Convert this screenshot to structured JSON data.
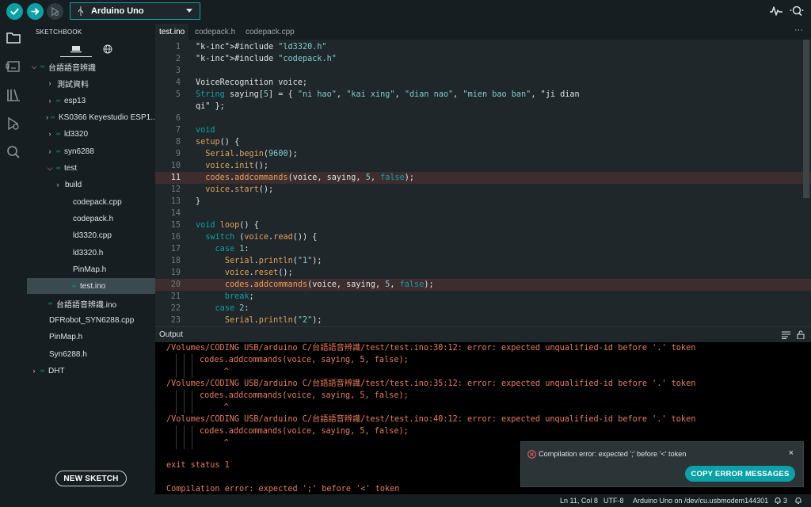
{
  "toolbar": {
    "board_label": "Arduino Uno",
    "verify_icon": "check-icon",
    "upload_icon": "arrow-right-icon",
    "debug_icon": "debug-icon",
    "accent_color": "#0ca1a6"
  },
  "sidebar": {
    "title": "SKETCHBOOK",
    "tree": [
      {
        "label": "台語語音辨識",
        "caret": "⌵",
        "sketch": true
      },
      {
        "label": "測試資料",
        "caret": "›",
        "sketch": false
      },
      {
        "label": "esp13",
        "caret": "›",
        "sketch": true
      },
      {
        "label": "KS0366 Keyestudio ESP1...",
        "caret": "›",
        "sketch": true
      },
      {
        "label": "ld3320",
        "caret": "›",
        "sketch": true
      },
      {
        "label": "syn6288",
        "caret": "›",
        "sketch": true
      },
      {
        "label": "test",
        "caret": "⌵",
        "sketch": true
      },
      {
        "label": "build",
        "caret": "›",
        "sketch": false
      },
      {
        "label": "codepack.cpp",
        "caret": "",
        "sketch": false
      },
      {
        "label": "codepack.h",
        "caret": "",
        "sketch": false
      },
      {
        "label": "ld3320.cpp",
        "caret": "",
        "sketch": false
      },
      {
        "label": "ld3320.h",
        "caret": "",
        "sketch": false
      },
      {
        "label": "PinMap.h",
        "caret": "",
        "sketch": false
      },
      {
        "label": "test.ino",
        "caret": "",
        "sketch": true
      },
      {
        "label": "台語語音辨識.ino",
        "caret": "",
        "sketch": true
      },
      {
        "label": "DFRobot_SYN6288.cpp",
        "caret": "",
        "sketch": false
      },
      {
        "label": "PinMap.h",
        "caret": "",
        "sketch": false
      },
      {
        "label": "Syn6288.h",
        "caret": "",
        "sketch": false
      },
      {
        "label": "DHT",
        "caret": "›",
        "sketch": true
      }
    ],
    "new_sketch_label": "NEW SKETCH"
  },
  "editor": {
    "tabs": [
      {
        "label": "test.ino",
        "active": true
      },
      {
        "label": "codepack.h",
        "active": false
      },
      {
        "label": "codepack.cpp",
        "active": false
      }
    ],
    "more_label": "···",
    "lines": [
      {
        "n": "1",
        "code": "#include \"ld3320.h\"",
        "error": false
      },
      {
        "n": "2",
        "code": "#include \"codepack.h\"",
        "error": false
      },
      {
        "n": "3",
        "code": "",
        "error": false
      },
      {
        "n": "4",
        "code": "VoiceRecognition voice;",
        "error": false
      },
      {
        "n": "5",
        "code": "String saying[5] = { \"ni hao\", \"kai xing\", \"dian nao\", \"mien bao ban\", \"ji dian",
        "error": false
      },
      {
        "n": "",
        "code": "qi\" };",
        "error": false
      },
      {
        "n": "6",
        "code": "",
        "error": false
      },
      {
        "n": "7",
        "code": "void",
        "error": false
      },
      {
        "n": "8",
        "code": "setup() {",
        "error": false
      },
      {
        "n": "9",
        "code": "  Serial.begin(9600);",
        "error": false
      },
      {
        "n": "10",
        "code": "  voice.init();",
        "error": false
      },
      {
        "n": "11",
        "code": "  codes.addcommands(voice, saying, 5, false);",
        "error": true
      },
      {
        "n": "12",
        "code": "  voice.start();",
        "error": false
      },
      {
        "n": "13",
        "code": "}",
        "error": false
      },
      {
        "n": "14",
        "code": "",
        "error": false
      },
      {
        "n": "15",
        "code": "void loop() {",
        "error": false
      },
      {
        "n": "16",
        "code": "  switch (voice.read()) {",
        "error": false
      },
      {
        "n": "17",
        "code": "    case 1:",
        "error": false
      },
      {
        "n": "18",
        "code": "      Serial.println(\"1\");",
        "error": false
      },
      {
        "n": "19",
        "code": "      voice.reset();",
        "error": false
      },
      {
        "n": "20",
        "code": "      codes.addcommands(voice, saying, 5, false);",
        "error": true
      },
      {
        "n": "21",
        "code": "      break;",
        "error": false
      },
      {
        "n": "22",
        "code": "    case 2:",
        "error": false
      },
      {
        "n": "23",
        "code": "      Serial.println(\"2\");",
        "error": false
      }
    ]
  },
  "output": {
    "title": "Output",
    "lines": [
      {
        "text": "/Volumes/CODING USB/arduino C/台語語音辨識/test/test.ino:30:12: error: expected unqualified-id before '.' token",
        "indent": false
      },
      {
        "text": "codes.addcommands(voice, saying, 5, false);",
        "indent": true
      },
      {
        "text": "     ^",
        "indent": true
      },
      {
        "text": "/Volumes/CODING USB/arduino C/台語語音辨識/test/test.ino:35:12: error: expected unqualified-id before '.' token",
        "indent": false
      },
      {
        "text": "codes.addcommands(voice, saying, 5, false);",
        "indent": true
      },
      {
        "text": "     ^",
        "indent": true
      },
      {
        "text": "/Volumes/CODING USB/arduino C/台語語音辨識/test/test.ino:40:12: error: expected unqualified-id before '.' token",
        "indent": false
      },
      {
        "text": "codes.addcommands(voice, saying, 5, false);",
        "indent": true
      },
      {
        "text": "     ^",
        "indent": true
      },
      {
        "text": "",
        "indent": false
      },
      {
        "text": "exit status 1",
        "indent": false
      },
      {
        "text": "",
        "indent": false
      },
      {
        "text": "Compilation error: expected ';' before '<' token",
        "indent": false
      }
    ]
  },
  "notification": {
    "message": "Compilation error: expected ';' before '<' token",
    "close_label": "×",
    "copy_label": "COPY ERROR MESSAGES"
  },
  "statusbar": {
    "position": "Ln 11, Col 8",
    "encoding": "UTF-8",
    "board_port": "Arduino Uno on /dev/cu.usbmodem144301",
    "notif_count": "3"
  }
}
